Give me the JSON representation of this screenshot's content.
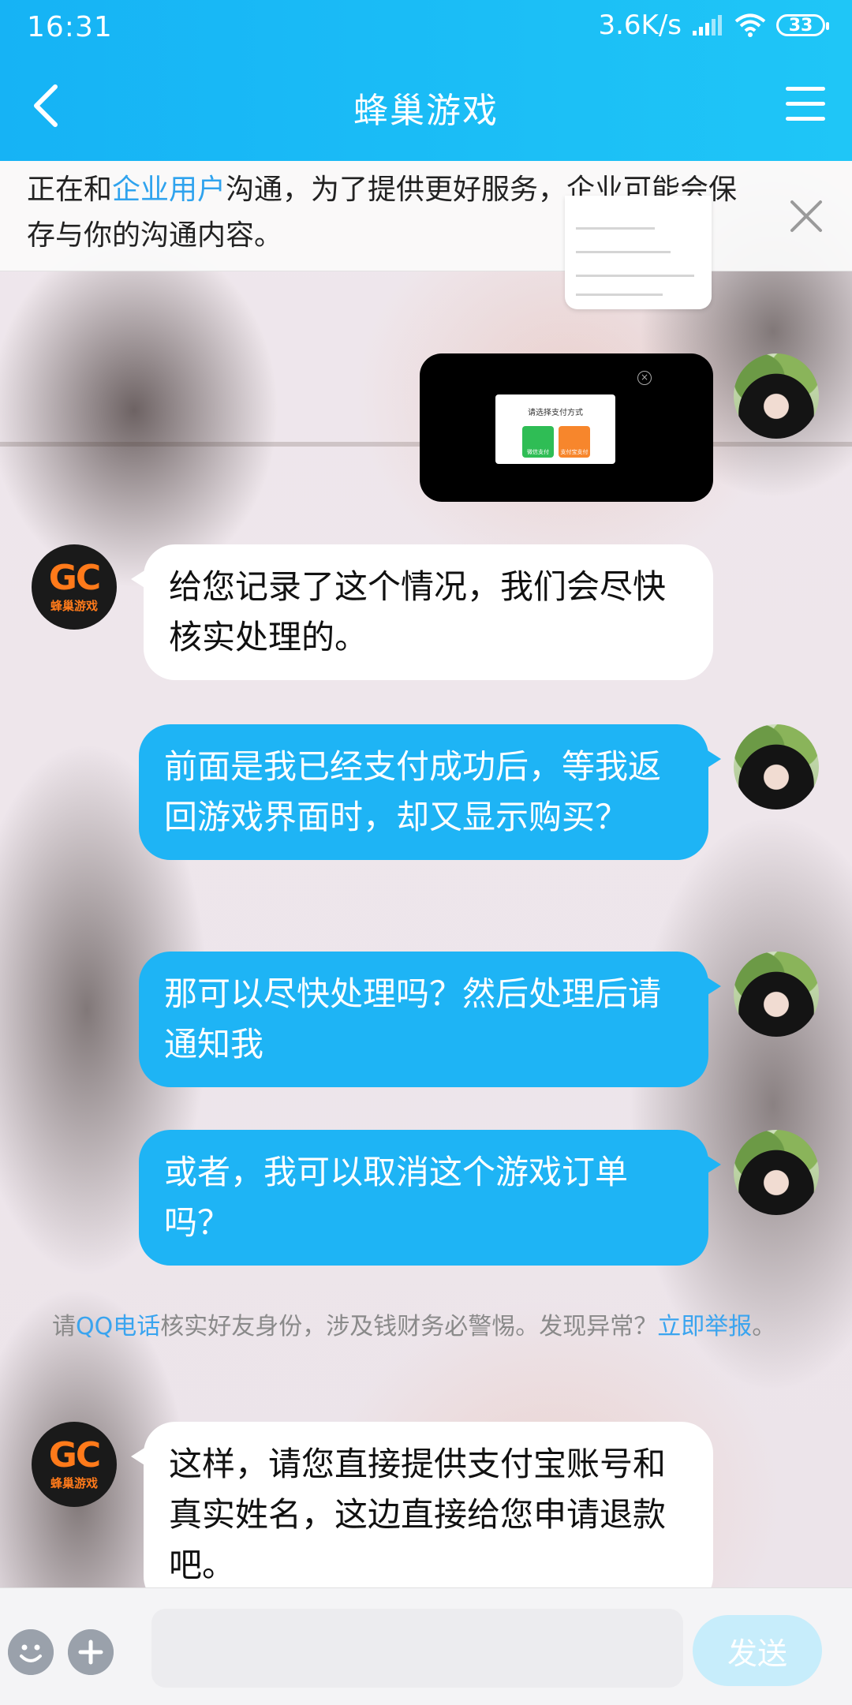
{
  "status_bar": {
    "time": "16:31",
    "net_speed": "3.6K/s",
    "battery": "33"
  },
  "header": {
    "title": "蜂巢游戏"
  },
  "notice": {
    "prefix": "正在和",
    "link": "企业用户",
    "suffix": "沟通，为了提供更好服务，企业可能会保存与你的沟通内容。"
  },
  "image_message": {
    "popup_title": "请选择支付方式",
    "option_wechat": "微信支付",
    "option_alipay": "支付宝支付"
  },
  "messages": [
    {
      "sender": "business",
      "text": "给您记录了这个情况，我们会尽快核实处理的。"
    },
    {
      "sender": "user",
      "text": "前面是我已经支付成功后，等我返回游戏界面时，却又显示购买？"
    },
    {
      "sender": "user",
      "text": "那可以尽快处理吗？然后处理后请通知我"
    },
    {
      "sender": "user",
      "text": "或者，我可以取消这个游戏订单吗？"
    },
    {
      "sender": "business",
      "text": "这样，请您直接提供支付宝账号和真实姓名，这边直接给您申请退款吧。"
    }
  ],
  "business_avatar": {
    "logo": "GC",
    "name": "蜂巢游戏"
  },
  "safety_tip": {
    "prefix": "请",
    "link1": "QQ电话",
    "middle": "核实好友身份，涉及钱财务必警惕。发现异常？",
    "link2": "立即举报",
    "suffix": "。"
  },
  "input_bar": {
    "placeholder": "",
    "send_label": "发送"
  },
  "colors": {
    "header": "#16b3f5",
    "user_bubble": "#1eb4f5",
    "link": "#2fa3ee"
  }
}
